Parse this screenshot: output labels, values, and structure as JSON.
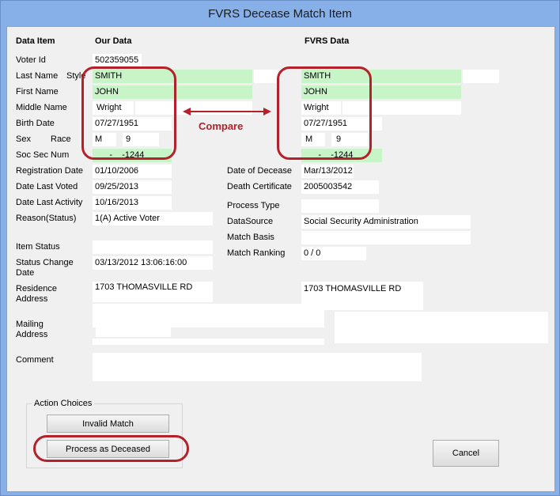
{
  "window": {
    "title": "FVRS Decease Match Item"
  },
  "headers": {
    "data_item": "Data Item",
    "our_data": "Our Data",
    "fvrs_data": "FVRS Data"
  },
  "labels": {
    "voter_id": "Voter Id",
    "last_name": "Last Name",
    "style": "Style",
    "first_name": "First Name",
    "middle_name": "Middle Name",
    "birth_date": "Birth Date",
    "sex": "Sex",
    "race": "Race",
    "soc_sec_num": "Soc Sec Num",
    "registration_date": "Registration Date",
    "date_last_voted": "Date Last Voted",
    "date_last_activity": "Date Last Activity",
    "reason_status": "Reason(Status)",
    "item_status": "Item Status",
    "status_change_date": "Status Change Date",
    "residence_address": "Residence Address",
    "mailing_address": "Mailing Address",
    "comment": "Comment",
    "date_of_decease": "Date of Decease",
    "death_certificate": "Death Certificate",
    "process_type": "Process Type",
    "data_source": "DataSource",
    "match_basis": "Match Basis",
    "match_ranking": "Match Ranking"
  },
  "our": {
    "voter_id": "502359055",
    "last_name": "SMITH",
    "first_name": "JOHN",
    "middle_name": "Wright",
    "birth_date": "07/27/1951",
    "sex": "M",
    "race": "9",
    "ssn": "___-__-1244",
    "registration_date": "01/10/2006",
    "date_last_voted": "09/25/2013",
    "date_last_activity": "10/16/2013",
    "reason_status": "1(A) Active Voter",
    "item_status": "",
    "status_change_date": "03/13/2012 13:06:16:00",
    "residence_address": "1703 THOMASVILLE RD"
  },
  "fvrs": {
    "last_name": "SMITH",
    "first_name": "JOHN",
    "middle_name": "Wright",
    "birth_date": "07/27/1951",
    "sex": "M",
    "race": "9",
    "ssn": "___-__-1244",
    "date_of_decease": "Mar/13/2012",
    "death_certificate": "2005003542",
    "process_type": "",
    "data_source": "Social Security Administration",
    "match_basis": "",
    "match_ranking": "0 / 0",
    "residence_address": "1703 THOMASVILLE RD"
  },
  "annotation": {
    "compare": "Compare"
  },
  "actions": {
    "group_title": "Action Choices",
    "invalid_match": "Invalid Match",
    "process_as_deceased": "Process as Deceased",
    "cancel": "Cancel"
  },
  "colors": {
    "match_green": "#c8f5c8",
    "annotation_red": "#b5212a",
    "title_bar": "#87b0e8"
  }
}
